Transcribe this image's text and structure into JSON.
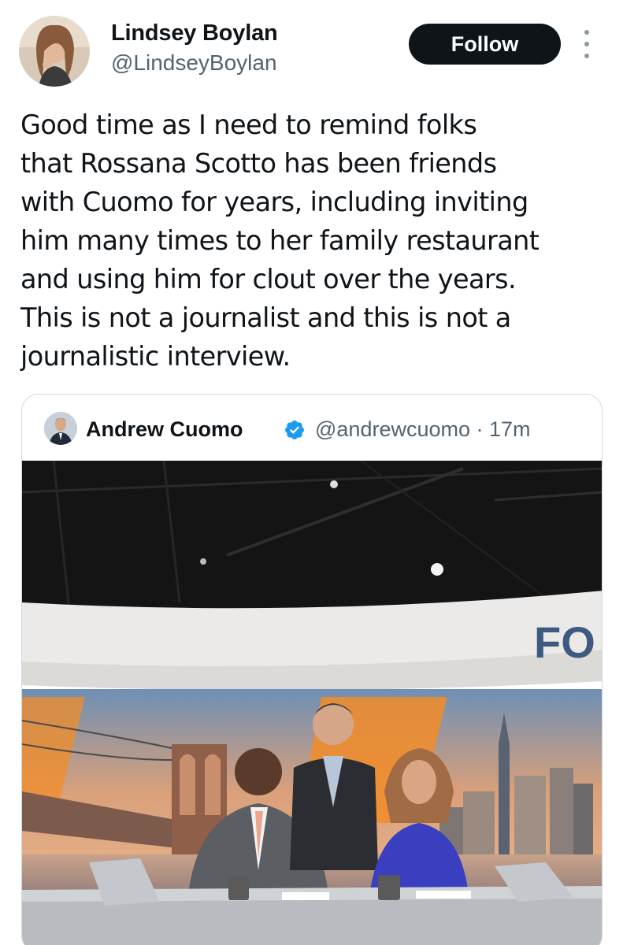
{
  "author": {
    "name": "Lindsey Boylan",
    "handle": "@LindseyBoylan",
    "avatar_icon": "profile-photo"
  },
  "actions": {
    "follow_label": "Follow",
    "more_icon": "vertical-ellipsis-icon"
  },
  "tweet": {
    "text": "Good time as I need to remind folks\nthat Rossana Scotto has been friends\nwith Cuomo for years, including inviting\nhim many times to her family restaurant\nand using him for clout over the years.\nThis is not a journalist and this is not a\njournalistic interview."
  },
  "quoted": {
    "name": "Andrew Cuomo",
    "verified_icon": "verified-badge-icon",
    "handle_time": "@andrewcuomo · 17m",
    "photo": {
      "description_icon": "studio-photo",
      "set_sign": "FO"
    }
  },
  "colors": {
    "follow_bg": "#0f1419",
    "verified": "#1d9bf0",
    "secondary_text": "#536471",
    "border": "#cfd9de"
  }
}
